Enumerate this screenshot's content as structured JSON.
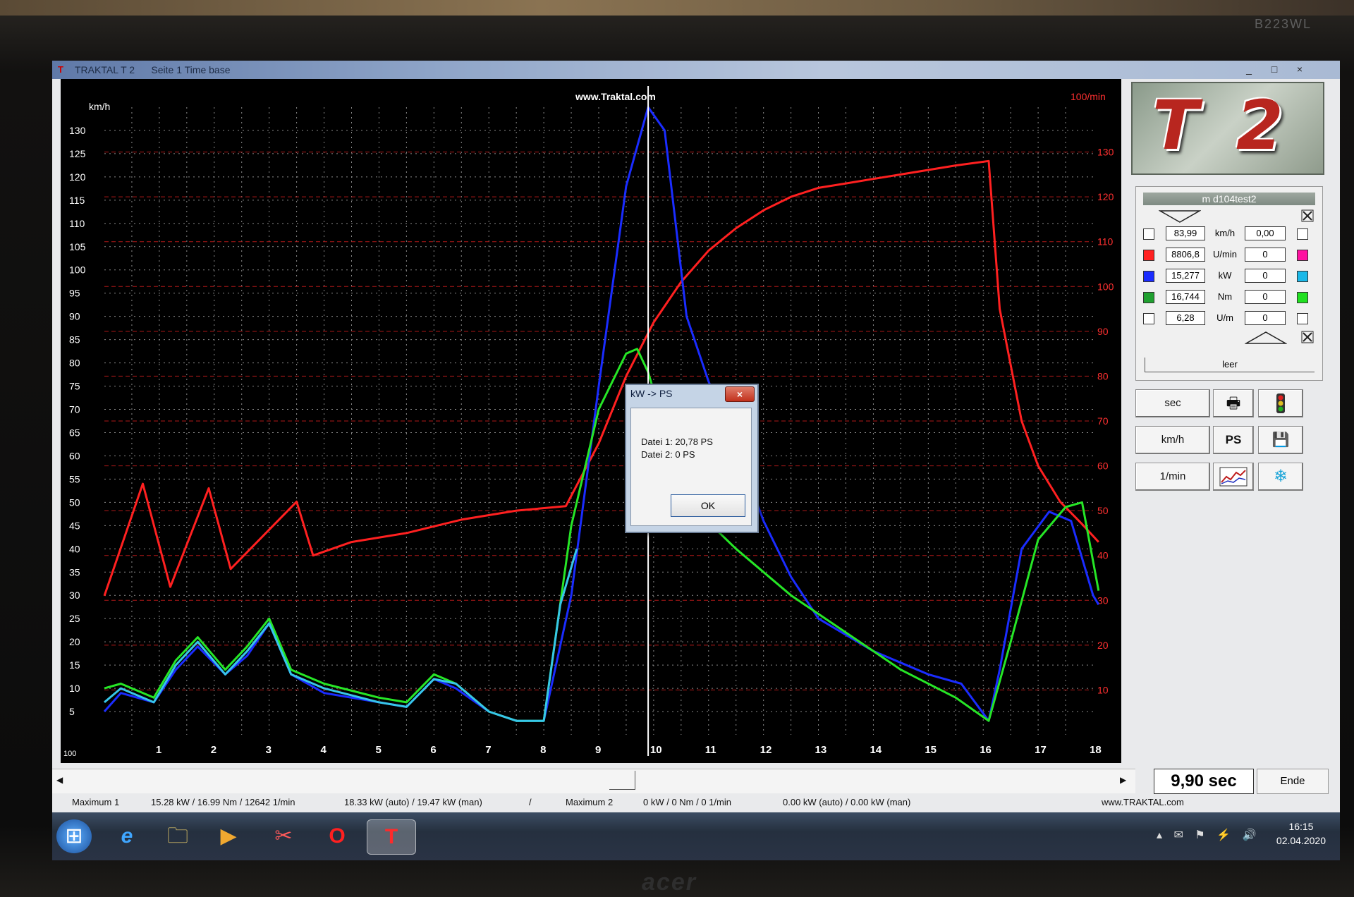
{
  "monitor": {
    "model": "B223WL",
    "brand": "acer"
  },
  "window": {
    "title": "TRAKTAL  T 2",
    "subtitle": "Seite 1   Time base",
    "controls": [
      "_",
      "□",
      "×"
    ]
  },
  "plot": {
    "watermark": "www.Traktal.com",
    "left_unit": "km/h",
    "right_unit": "100/min",
    "left_ticks": [
      "130",
      "125",
      "120",
      "115",
      "110",
      "105",
      "100",
      "95",
      "90",
      "85",
      "80",
      "75",
      "70",
      "65",
      "60",
      "55",
      "50",
      "45",
      "40",
      "35",
      "30",
      "25",
      "20",
      "15",
      "10",
      "5"
    ],
    "right_ticks": [
      "130",
      "120",
      "110",
      "100",
      "90",
      "80",
      "70",
      "60",
      "50",
      "40",
      "30",
      "20",
      "10"
    ],
    "x_ticks": [
      "1",
      "2",
      "3",
      "4",
      "5",
      "6",
      "7",
      "8",
      "9",
      "10",
      "11",
      "12",
      "13",
      "14",
      "15",
      "16",
      "17",
      "18"
    ],
    "x_origin": "100",
    "cursor_x": 9.9
  },
  "chart_data": {
    "type": "line",
    "x_label": "sec",
    "xlim": [
      0,
      18
    ],
    "ylim_left": [
      0,
      135
    ],
    "ylim_right": [
      0,
      140
    ],
    "series": [
      {
        "name": "U/min",
        "color": "#ff2020",
        "axis": "right",
        "x": [
          0,
          0.7,
          1.2,
          1.9,
          2.3,
          3.5,
          3.7,
          3.8,
          4.5,
          5.5,
          6.5,
          7.5,
          8.4,
          9,
          9.5,
          10,
          10.5,
          11,
          11.5,
          12,
          12.5,
          13,
          13.5,
          14,
          15,
          15.5,
          16.1,
          16.3,
          16.7,
          17,
          17.4,
          17.8,
          18.1
        ],
        "y": [
          31,
          56,
          33,
          55,
          37,
          52,
          44,
          40,
          43,
          45,
          48,
          50,
          51,
          65,
          80,
          92,
          101,
          108,
          113,
          117,
          120,
          122,
          123,
          124,
          126,
          127,
          128,
          95,
          70,
          60,
          52,
          47,
          43
        ]
      },
      {
        "name": "kW",
        "color": "#1a2cff",
        "axis": "left",
        "x": [
          0,
          0.3,
          0.9,
          1.3,
          1.7,
          2.2,
          2.6,
          3,
          3.4,
          4,
          5,
          5.5,
          6,
          6.4,
          7,
          7.5,
          8,
          8.5,
          9,
          9.5,
          9.9,
          10.2,
          10.6,
          11,
          11.5,
          12,
          12.5,
          13,
          14,
          15,
          15.6,
          16.1,
          16.3,
          16.7,
          17.2,
          17.6,
          18,
          18.1
        ],
        "y": [
          5,
          9,
          7,
          14,
          19,
          13,
          17,
          24,
          13,
          9,
          7,
          6,
          12,
          10,
          5,
          3,
          3,
          30,
          75,
          118,
          135,
          130,
          90,
          76,
          62,
          46,
          34,
          25,
          18,
          13,
          11,
          3,
          14,
          40,
          48,
          46,
          30,
          28
        ]
      },
      {
        "name": "Nm",
        "color": "#26e626",
        "axis": "left",
        "x": [
          0,
          0.3,
          0.9,
          1.3,
          1.7,
          2.2,
          2.6,
          3,
          3.4,
          4,
          5,
          5.5,
          6,
          6.4,
          7,
          7.5,
          8,
          8.5,
          9,
          9.5,
          9.7,
          9.9,
          10.3,
          10.8,
          11.5,
          12.5,
          13.5,
          14.5,
          15.5,
          16.1,
          16.5,
          17,
          17.5,
          17.8,
          18.1
        ],
        "y": [
          10,
          11,
          8,
          16,
          21,
          14,
          19,
          25,
          14,
          11,
          8,
          7,
          13,
          11,
          5,
          3,
          3,
          45,
          70,
          82,
          83,
          78,
          62,
          48,
          40,
          30,
          22,
          14,
          8,
          3,
          20,
          42,
          49,
          50,
          31
        ]
      },
      {
        "name": "U/m",
        "color": "#37c6e8",
        "axis": "left",
        "x": [
          0,
          0.3,
          0.9,
          1.3,
          1.7,
          2.2,
          2.6,
          3,
          3.4,
          4,
          5,
          5.5,
          6,
          6.4,
          7,
          7.5,
          8,
          8.3,
          8.6
        ],
        "y": [
          7,
          10,
          7,
          15,
          20,
          13,
          18,
          24,
          13,
          10,
          7,
          6,
          12,
          11,
          5,
          3,
          3,
          28,
          40
        ]
      }
    ]
  },
  "side": {
    "file_name": "m d104test2",
    "leer_label": "leer",
    "rows": [
      {
        "value": "83,99",
        "unit": "km/h",
        "value2": "0,00",
        "color1": "#ffffff",
        "color2": "#ffffff"
      },
      {
        "value": "8806,8",
        "unit": "U/min",
        "value2": "0",
        "color1": "#ff2020",
        "color2": "#ff10a0"
      },
      {
        "value": "15,277",
        "unit": "kW",
        "value2": "0",
        "color1": "#1a2cff",
        "color2": "#19b8e8"
      },
      {
        "value": "16,744",
        "unit": "Nm",
        "value2": "0",
        "color1": "#20a030",
        "color2": "#20e020"
      },
      {
        "value": "6,28",
        "unit": "U/m",
        "value2": "0",
        "color1": "#ffffff",
        "color2": "#ffffff"
      }
    ],
    "buttons": {
      "sec": "sec",
      "kmh": "km/h",
      "ps": "PS",
      "rpm": "1/min",
      "print_icon": "printer-icon",
      "traffic_icon": "traffic-light-icon",
      "save_icon": "save-icon",
      "graph_icon": "graph-icon",
      "snow_icon": "snowflake-icon"
    }
  },
  "time_display": "9,90 sec",
  "ende_label": "Ende",
  "status": {
    "max1_label": "Maximum 1",
    "max1_vals": "15.28 kW  /  16.99 Nm  /  12642 1/min",
    "max1_auto": "18.33 kW (auto)  /  19.47 kW (man)",
    "sep": "/",
    "max2_label": "Maximum 2",
    "max2_vals": "0 kW  /  0 Nm  /  0 1/min",
    "max2_auto": "0.00 kW (auto)  /  0.00 kW (man)",
    "site": "www.TRAKTAL.com"
  },
  "dialog": {
    "title": "kW -> PS",
    "close": "×",
    "line1": "Datei 1: 20,78 PS",
    "line2": "Datei 2: 0 PS",
    "ok": "OK"
  },
  "taskbar": {
    "time": "16:15",
    "date": "02.04.2020",
    "icons": [
      "windows-start-icon",
      "ie-icon",
      "explorer-icon",
      "media-player-icon",
      "snipping-tool-icon",
      "opera-icon",
      "traktal-icon"
    ]
  }
}
